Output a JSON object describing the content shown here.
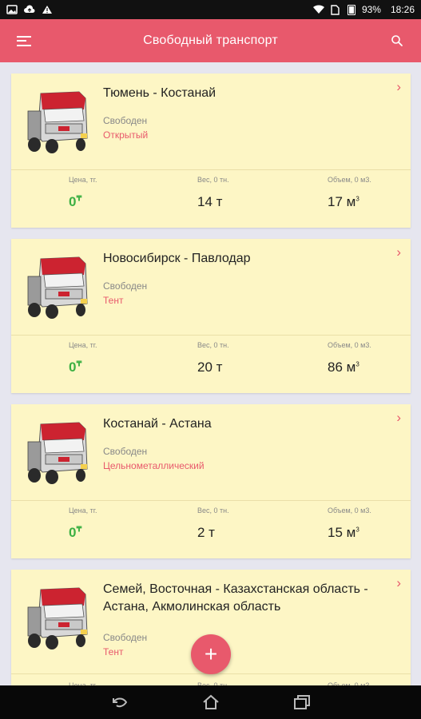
{
  "status_bar": {
    "battery": "93%",
    "time": "18:26",
    "icons": [
      "gallery-icon",
      "cloud-upload-icon",
      "warning-icon",
      "wifi-icon",
      "sim-icon",
      "battery-icon"
    ]
  },
  "app_bar": {
    "title": "Свободный транспорт",
    "menu_icon": "menu-icon",
    "search_icon": "search-icon"
  },
  "labels": {
    "price": "Цена, тг.",
    "weight": "Вес, 0 тн.",
    "volume": "Объем, 0 м3."
  },
  "cards": [
    {
      "route": "Тюмень - Костанай",
      "status": "Свободен",
      "type": "Открытый",
      "price": "0",
      "weight": "14 т",
      "volume": "17 м"
    },
    {
      "route": "Новосибирск - Павлодар",
      "status": "Свободен",
      "type": "Тент",
      "price": "0",
      "weight": "20 т",
      "volume": "86 м"
    },
    {
      "route": "Костанай - Астана",
      "status": "Свободен",
      "type": "Цельнометаллический",
      "price": "0",
      "weight": "2 т",
      "volume": "15 м"
    },
    {
      "route": "Семей, Восточная - Казахстанская область - Астана, Акмолинская область",
      "status": "Свободен",
      "type": "Тент",
      "price": "",
      "weight": "",
      "volume": ""
    }
  ],
  "currency_symbol": "₸",
  "volume_superscript": "3",
  "fab_label": "+",
  "nav_bar": {
    "buttons": [
      "back-icon",
      "home-icon",
      "recents-icon"
    ]
  },
  "colors": {
    "accent": "#e8596c",
    "card_bg": "#fdf6c5",
    "price": "#3cb043",
    "background": "#e6e6ef"
  }
}
